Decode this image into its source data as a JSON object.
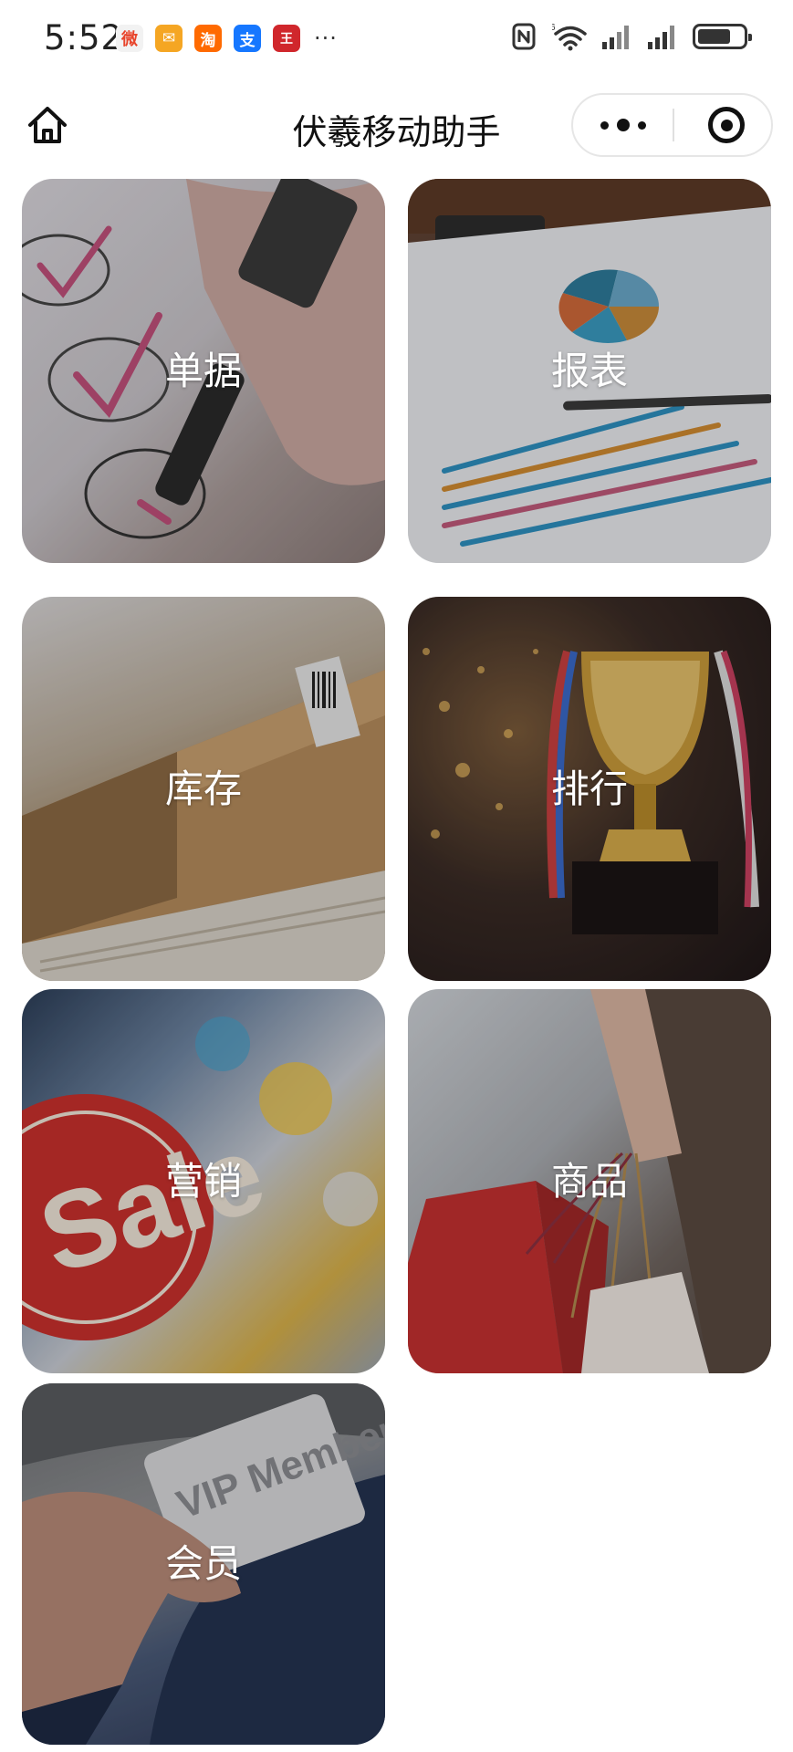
{
  "status_bar": {
    "time": "5:52",
    "notification_icons": [
      "weibo-icon",
      "mail-icon",
      "taobao-icon",
      "alipay-icon",
      "app-icon"
    ],
    "notification_glyphs": [
      "微",
      "✉",
      "淘",
      "支",
      "王"
    ],
    "more": "···",
    "wifi_badge": "6"
  },
  "nav": {
    "title": "伏羲移动助手"
  },
  "tiles": [
    {
      "label": "单据"
    },
    {
      "label": "报表"
    },
    {
      "label": "库存"
    },
    {
      "label": "排行"
    },
    {
      "label": "营销"
    },
    {
      "label": "商品"
    },
    {
      "label": "会员"
    }
  ],
  "tile_image_subjects": {
    "tile_4_trophy_text": "",
    "tile_5_sign_text": "Sale",
    "tile_7_card_text": "VIP Member"
  },
  "colors": {
    "background": "#ffffff",
    "tile_label": "#ffffff",
    "sale_sign": "#c8302c"
  }
}
